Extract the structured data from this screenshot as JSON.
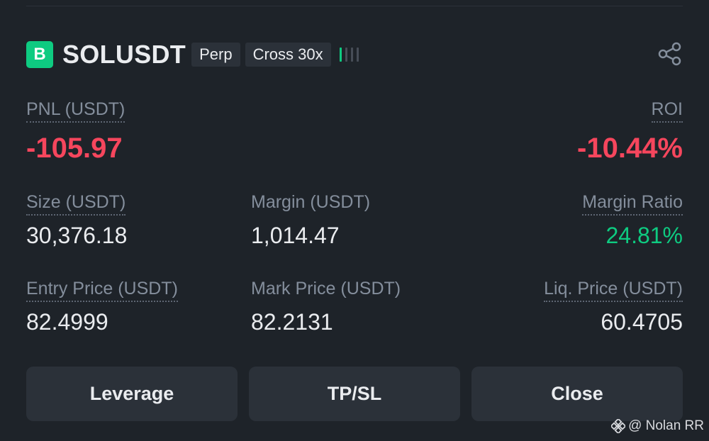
{
  "header": {
    "badge_letter": "B",
    "symbol": "SOLUSDT",
    "tags": [
      "Perp",
      "Cross 30x"
    ]
  },
  "risk_indicator": {
    "filled_bars": 1,
    "total_bars": 4,
    "active_color": "#0ecb81",
    "inactive_color": "#474d57"
  },
  "icons": {
    "share": "share-icon",
    "watermark": "binance-logo-icon"
  },
  "pnl": {
    "label": "PNL (USDT)",
    "value": "-105.97"
  },
  "roi": {
    "label": "ROI",
    "value": "-10.44%"
  },
  "size": {
    "label": "Size (USDT)",
    "value": "30,376.18"
  },
  "margin": {
    "label": "Margin (USDT)",
    "value": "1,014.47"
  },
  "margin_ratio": {
    "label": "Margin Ratio",
    "value": "24.81%"
  },
  "entry_price": {
    "label": "Entry Price (USDT)",
    "value": "82.4999"
  },
  "mark_price": {
    "label": "Mark Price (USDT)",
    "value": "82.2131"
  },
  "liq_price": {
    "label": "Liq. Price (USDT)",
    "value": "60.4705"
  },
  "buttons": {
    "leverage": "Leverage",
    "tpsl": "TP/SL",
    "close": "Close"
  },
  "watermark": {
    "text": "@ Nolan RR"
  },
  "colors": {
    "background": "#1e2329",
    "negative": "#f6465d",
    "positive": "#0ecb81",
    "muted": "#848e9c",
    "button_bg": "#2b3139"
  }
}
